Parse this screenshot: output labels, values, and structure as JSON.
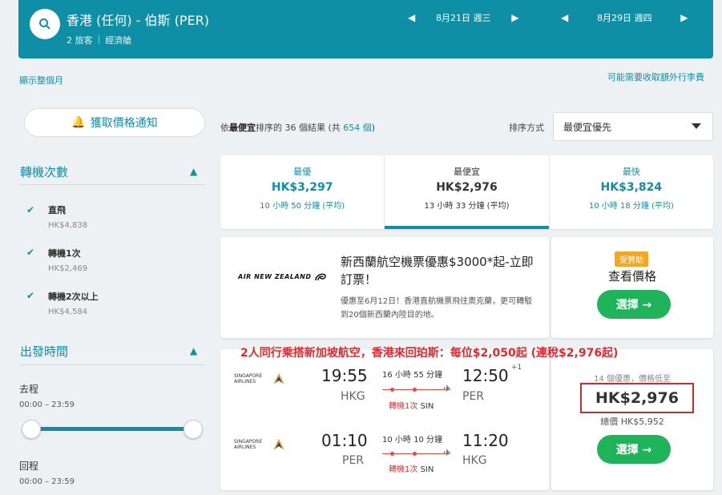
{
  "header": {
    "route": "香港 (任何) - 伯斯 (PER)",
    "travellers": "2 旅客",
    "cabin": "經濟艙",
    "depart_date": "8月21日 週三",
    "return_date": "8月29日 週四"
  },
  "links": {
    "show_month": "顯示整個月",
    "baggage_fees": "可能需要收取額外行李費"
  },
  "sidebar": {
    "alert_button": "獲取價格通知",
    "stops_title": "轉機次數",
    "stops": [
      {
        "label": "直飛",
        "price": "HK$4,838",
        "checked": true
      },
      {
        "label": "轉機1次",
        "price": "HK$2,469",
        "checked": true
      },
      {
        "label": "轉機2次以上",
        "price": "HK$4,584",
        "checked": true
      }
    ],
    "times_title": "出發時間",
    "outbound_label": "去程",
    "outbound_range": "00:00 – 23:59",
    "return_label": "回程",
    "return_range": "00:00 – 23:59"
  },
  "results": {
    "prefix": "依",
    "sort_bold": "最便宜",
    "middle": "排序的 36 個結果 (共",
    "total": "654 個",
    "suffix": ")",
    "sort_label": "排序方式",
    "sort_value": "最便宜優先"
  },
  "tabs": [
    {
      "name": "最優",
      "price": "HK$3,297",
      "duration": "10 小時 50 分鐘 (平均)",
      "active": false
    },
    {
      "name": "最便宜",
      "price": "HK$2,976",
      "duration": "13 小時 33 分鐘 (平均)",
      "active": true
    },
    {
      "name": "最快",
      "price": "HK$3,824",
      "duration": "10 小時 18 分鐘 (平均)",
      "active": false
    }
  ],
  "ad": {
    "logo_text": "AIR NEW ZEALAND",
    "title": "新西蘭航空機票優惠$3000*起-立即訂票！",
    "description": "優惠至6月12日！香港直航機票飛往奧克蘭，更可轉駁到20個新西蘭內陸目的地。",
    "sponsored": "受贊助",
    "view_price": "查看價格",
    "select": "選擇 →"
  },
  "overlay_text": "2人同行乘搭新加坡航空，香港來回珀斯：每位$2,050起 (連稅$2,976起)",
  "flight": {
    "airline_logo": "SINGAPORE AIRLINES",
    "outbound": {
      "depart_time": "19:55",
      "depart_code": "HKG",
      "duration": "16 小時 55 分鐘",
      "stops": "轉機1次",
      "via": "SIN",
      "arrive_time": "12:50",
      "day_offset": "+1",
      "arrive_code": "PER"
    },
    "inbound": {
      "depart_time": "01:10",
      "depart_code": "PER",
      "duration": "10 小時 10 分鐘",
      "stops": "轉機1次",
      "via": "SIN",
      "arrive_time": "11:20",
      "arrive_code": "HKG"
    },
    "deal_count": "14 個優惠，價格低至",
    "price": "HK$2,976",
    "total": "總價 HK$5,952",
    "select": "選擇 →"
  },
  "colors": {
    "brand": "#0e8fa6",
    "select_green": "#1fb35a",
    "highlight_red": "#e8262b"
  }
}
